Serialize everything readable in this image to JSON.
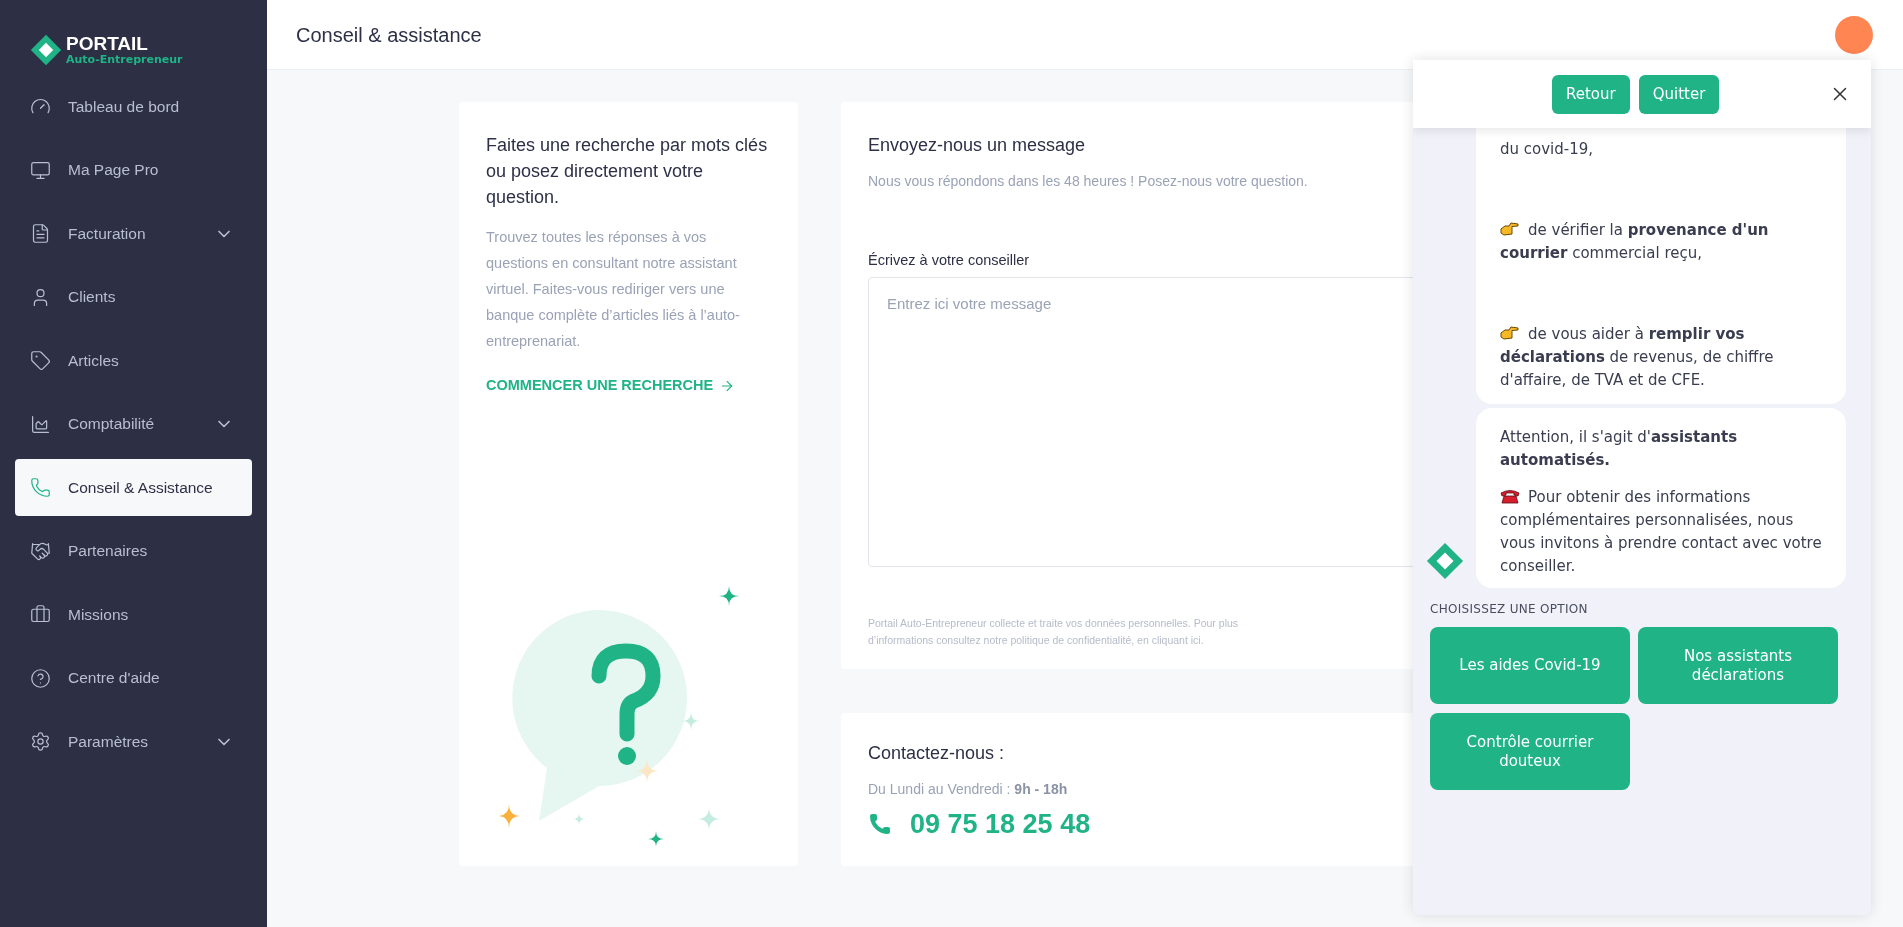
{
  "sidebar": {
    "logo": {
      "title": "PORTAIL",
      "subtitle": "Auto-Entrepreneur"
    },
    "items": [
      {
        "label": "Tableau de bord",
        "selected": false,
        "has_submenu": false
      },
      {
        "label": "Ma Page Pro",
        "selected": false,
        "has_submenu": false
      },
      {
        "label": "Facturation",
        "selected": false,
        "has_submenu": true
      },
      {
        "label": "Clients",
        "selected": false,
        "has_submenu": false
      },
      {
        "label": "Articles",
        "selected": false,
        "has_submenu": false
      },
      {
        "label": "Comptabilité",
        "selected": false,
        "has_submenu": true
      },
      {
        "label": "Conseil & Assistance",
        "selected": true,
        "has_submenu": false
      },
      {
        "label": "Partenaires",
        "selected": false,
        "has_submenu": false
      },
      {
        "label": "Missions",
        "selected": false,
        "has_submenu": false
      },
      {
        "label": "Centre d'aide",
        "selected": false,
        "has_submenu": false
      },
      {
        "label": "Paramètres",
        "selected": false,
        "has_submenu": true
      }
    ]
  },
  "header": {
    "title": "Conseil & assistance"
  },
  "search_card": {
    "title": "Faites une recherche par mots clés ou posez directement votre question.",
    "text": "Trouvez toutes les réponses à vos questions en consultant notre assistant virtuel. Faites-vous rediriger vers une banque complète d’articles liés à l’auto-entreprenariat.",
    "link": "COMMENCER UNE RECHERCHE"
  },
  "message_card": {
    "title": "Envoyez-nous un message",
    "subtitle": "Nous vous répondons dans les 48 heures ! Posez-nous votre question.",
    "field_label": "Écrivez à votre conseiller",
    "placeholder": "Entrez ici votre message",
    "privacy": "Portail Auto-Entrepreneur collecte et traite vos données personnelles. Pour plus d’informations consultez notre politique de confidentialité, en cliquant ici."
  },
  "contact_card": {
    "title": "Contactez-nous :",
    "hours": "Du Lundi au Vendredi : **9h - 18h**",
    "phone": "09 75 18 25 48"
  },
  "chat": {
    "buttons": [
      "Retour",
      "Quitter"
    ],
    "messages": [
      {
        "kind": "list",
        "paragraphs": [
          {
            "kind": "text",
            "text": "du covid-19,"
          },
          {
            "kind": "pointer",
            "text": "de vérifier la **provenance d'un courrier** commercial reçu,"
          },
          {
            "kind": "pointer",
            "text": "de vous aider à **remplir vos déclarations** de revenus, de chiffre d'affaire, de TVA et de CFE."
          }
        ]
      },
      {
        "kind": "notice",
        "paragraphs": [
          {
            "kind": "text",
            "text": "Attention, il s'agit d'**assistants automatisés.**"
          },
          {
            "kind": "phone",
            "text": "Pour obtenir des informations complémentaires personnalisées, nous vous invitons à prendre contact avec votre conseiller."
          }
        ]
      }
    ],
    "prompt": "CHOISISSEZ UNE OPTION",
    "options": [
      "Les aides Covid-19",
      "Nos assistants déclarations",
      "Contrôle courrier douteux"
    ]
  }
}
